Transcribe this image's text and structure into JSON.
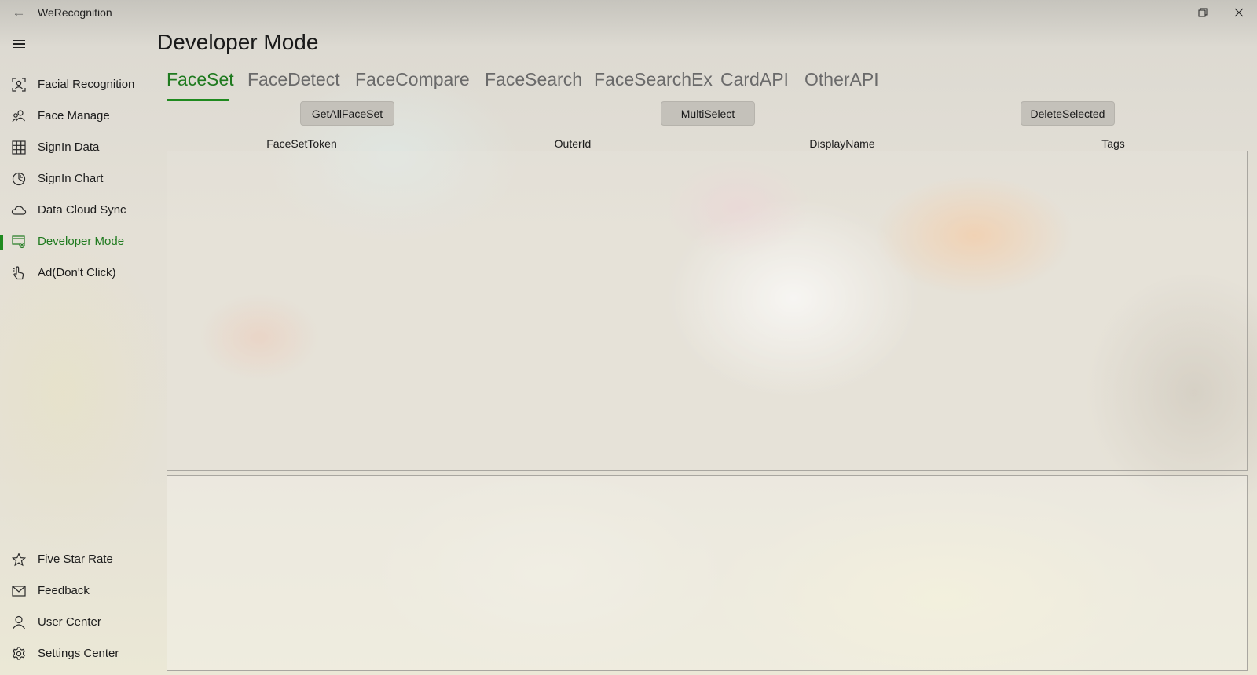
{
  "window": {
    "title": "WeRecognition",
    "back_icon": "back-arrow-icon",
    "controls": [
      "minimize-icon",
      "restore-icon",
      "close-icon"
    ]
  },
  "accent_color": "#1f8a1f",
  "sidebar": {
    "menu_icon": "hamburger-icon",
    "items": [
      {
        "label": "Facial Recognition",
        "icon": "face-scan-icon"
      },
      {
        "label": "Face Manage",
        "icon": "people-icon"
      },
      {
        "label": "SignIn Data",
        "icon": "grid-icon"
      },
      {
        "label": "SignIn Chart",
        "icon": "pie-chart-icon"
      },
      {
        "label": "Data Cloud Sync",
        "icon": "cloud-icon"
      },
      {
        "label": "Developer Mode",
        "icon": "developer-icon",
        "selected": true
      },
      {
        "label": "Ad(Don't Click)",
        "icon": "hand-pointer-icon"
      }
    ],
    "footer_items": [
      {
        "label": "Five Star Rate",
        "icon": "star-icon"
      },
      {
        "label": "Feedback",
        "icon": "mail-icon"
      },
      {
        "label": "User Center",
        "icon": "person-icon"
      },
      {
        "label": "Settings Center",
        "icon": "gear-icon"
      }
    ]
  },
  "main": {
    "title": "Developer Mode",
    "tabs": [
      {
        "label": "FaceSet",
        "active": true
      },
      {
        "label": "FaceDetect"
      },
      {
        "label": "FaceCompare"
      },
      {
        "label": "FaceSearch"
      },
      {
        "label": "FaceSearchEx"
      },
      {
        "label": "CardAPI"
      },
      {
        "label": "OtherAPI"
      }
    ],
    "buttons": {
      "get_all": "GetAllFaceSet",
      "multi_select": "MultiSelect",
      "delete_selected": "DeleteSelected"
    },
    "columns": [
      "FaceSetToken",
      "OuterId",
      "DisplayName",
      "Tags"
    ]
  }
}
